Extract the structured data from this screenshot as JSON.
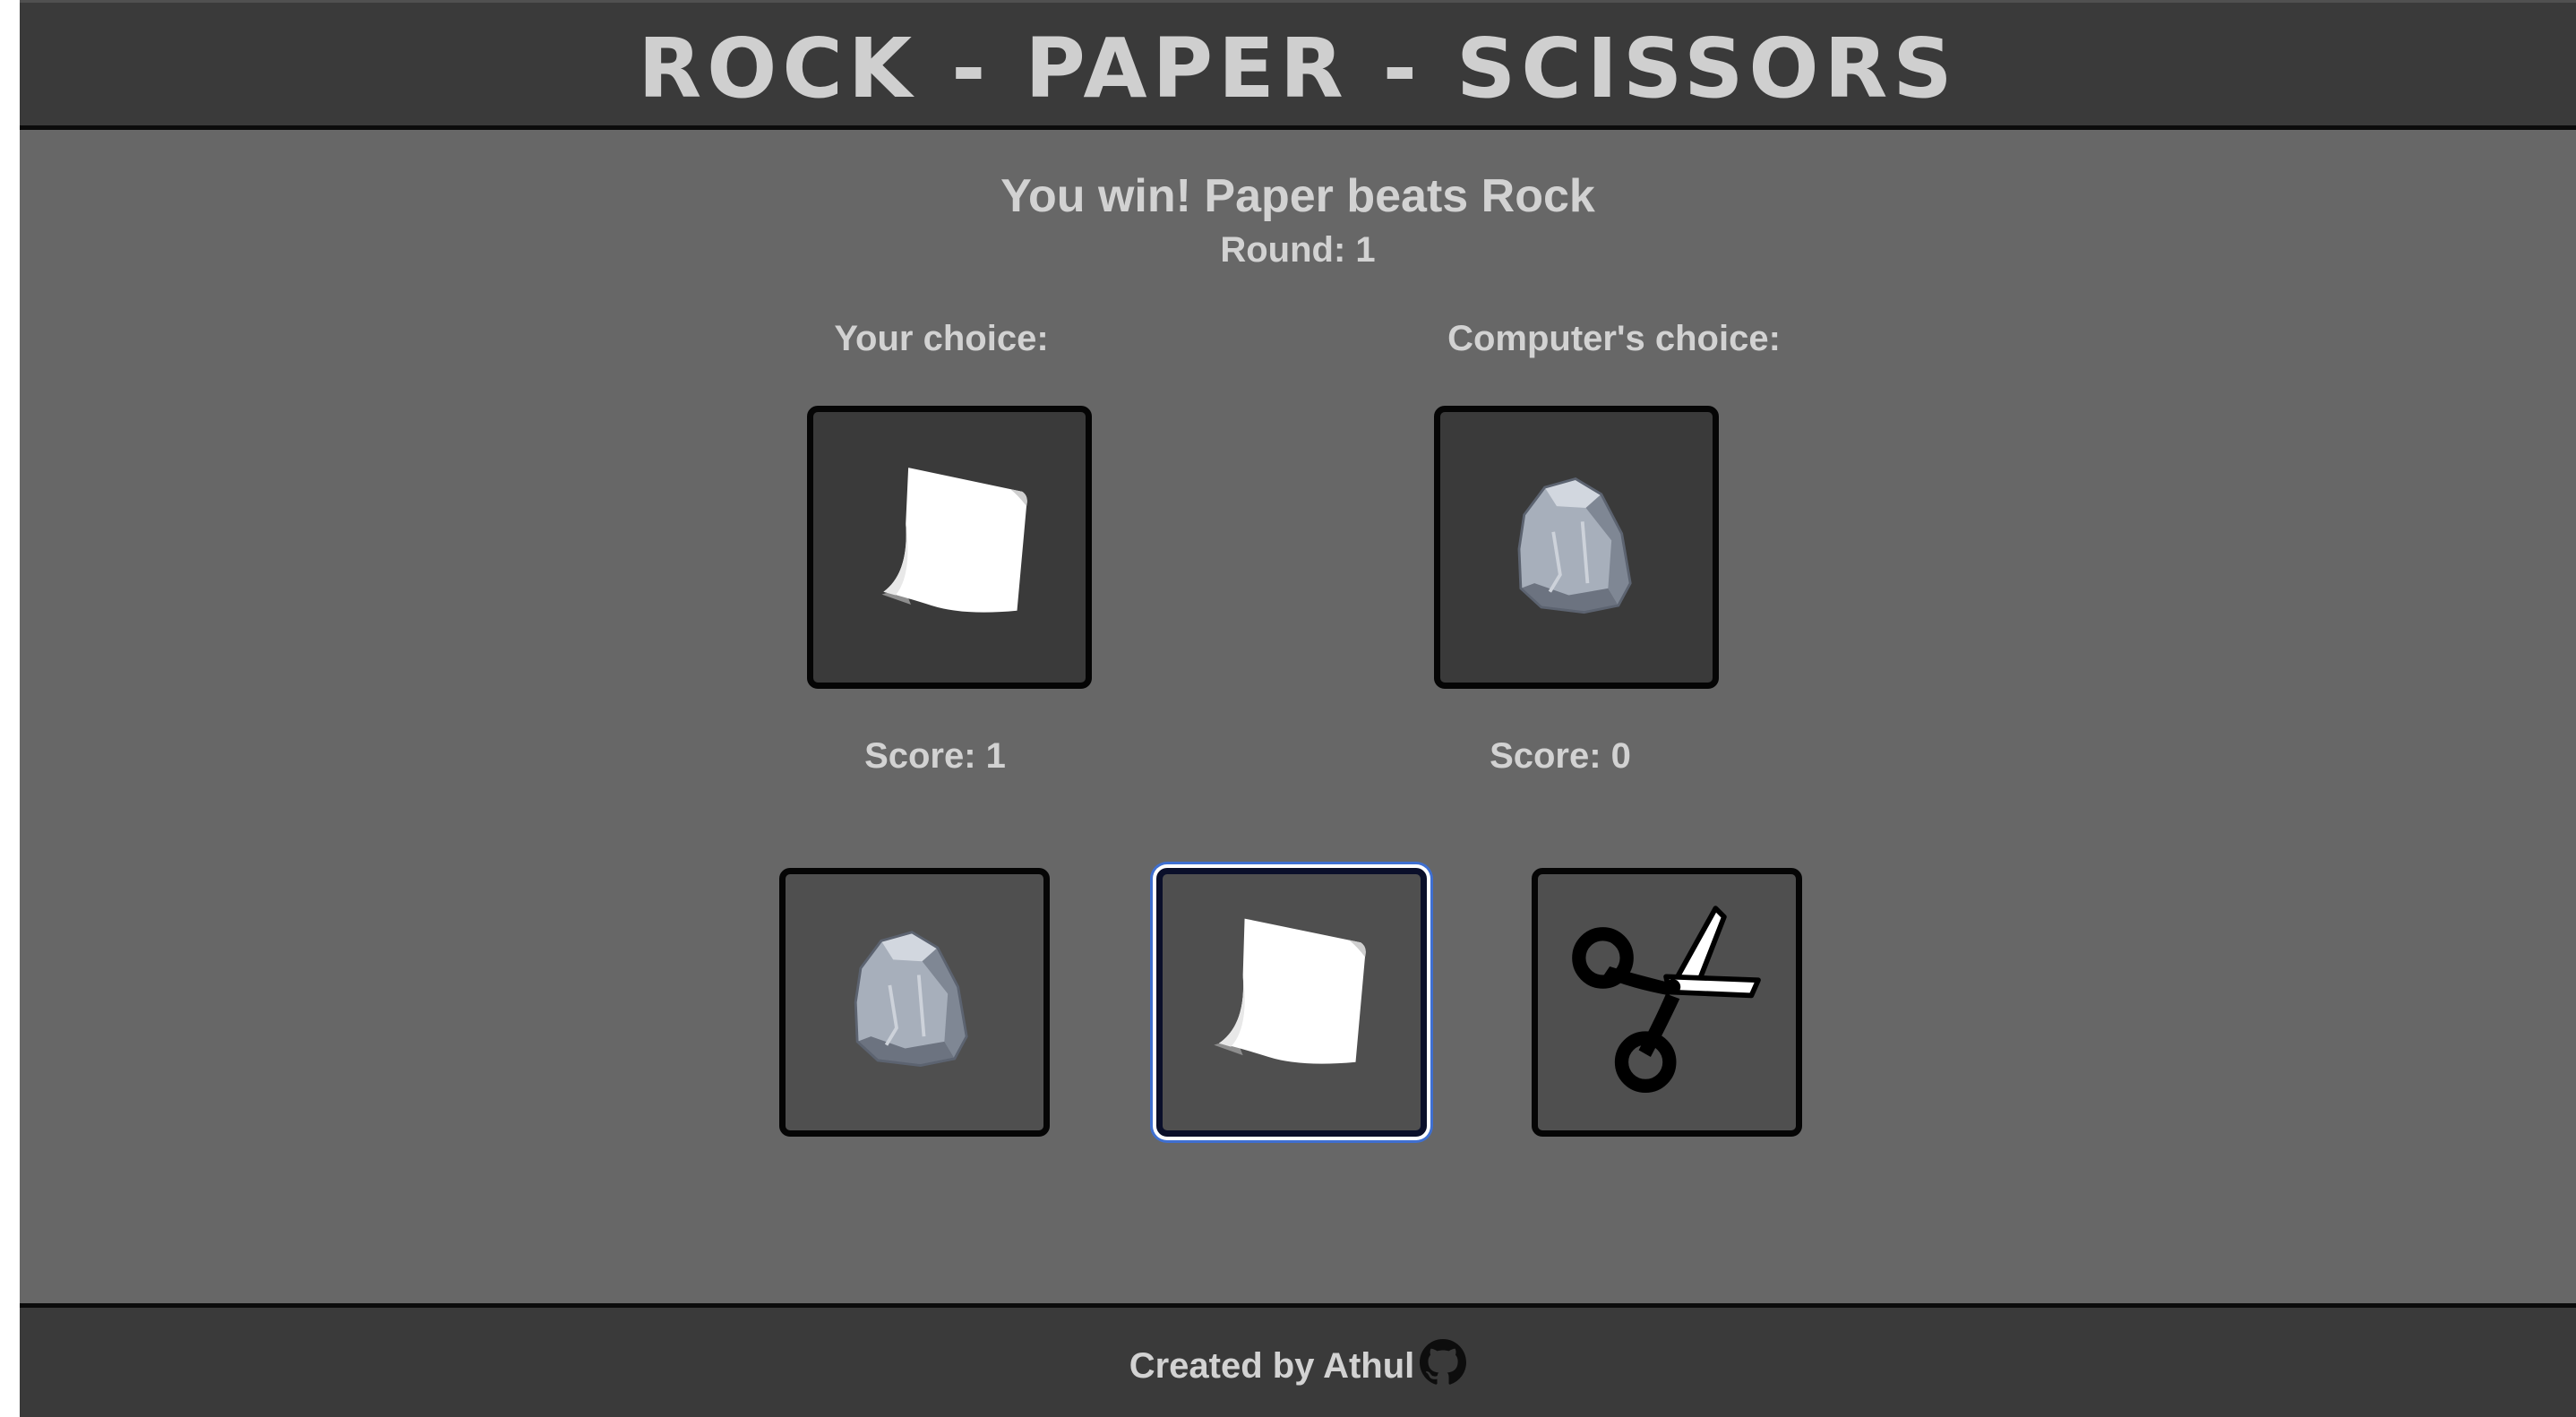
{
  "header": {
    "title": "ROCK - PAPER - SCISSORS"
  },
  "status": {
    "result_message": "You win! Paper beats Rock",
    "round_text": "Round: 1"
  },
  "player": {
    "label": "Your choice:",
    "choice": "paper",
    "score_text": "Score: 1"
  },
  "computer": {
    "label": "Computer's choice:",
    "choice": "rock",
    "score_text": "Score: 0"
  },
  "choices": [
    {
      "id": "rock",
      "icon": "rock-icon"
    },
    {
      "id": "paper",
      "icon": "paper-icon",
      "selected": true
    },
    {
      "id": "scissors",
      "icon": "scissors-icon"
    }
  ],
  "footer": {
    "credit_text": "Created by Athul",
    "icon": "github-icon"
  },
  "colors": {
    "header_bg": "#3a3a3a",
    "page_bg": "#676767",
    "text": "#d2d2d2",
    "selected_outline": "#3f6fd0"
  }
}
